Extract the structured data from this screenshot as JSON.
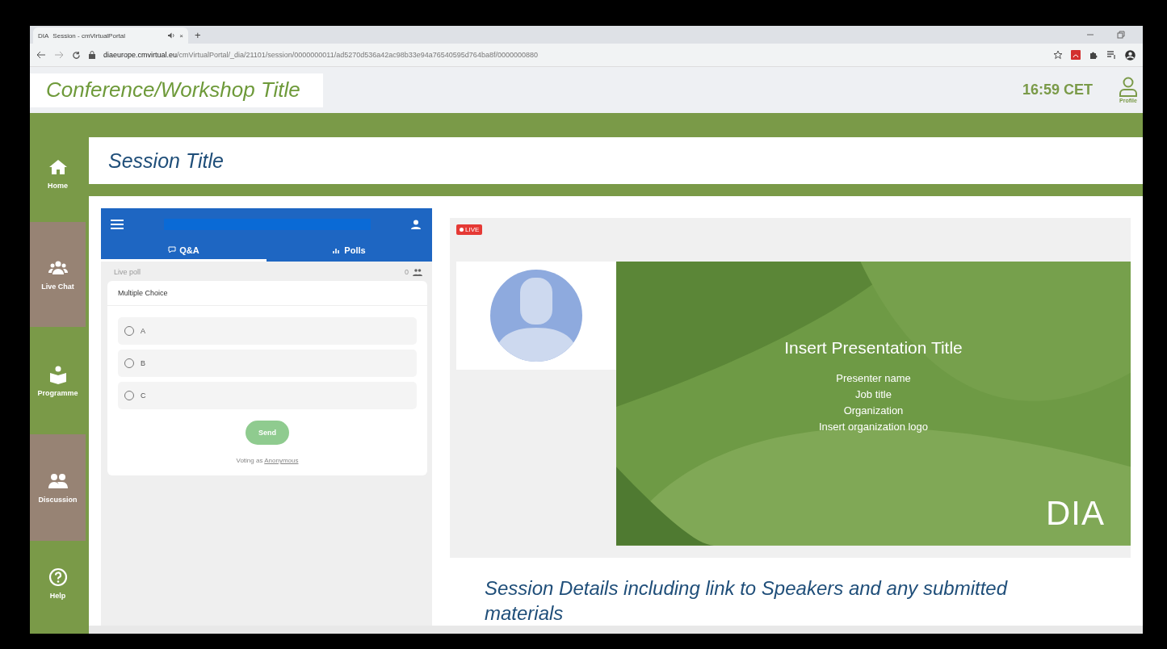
{
  "browser": {
    "tab": {
      "favicon": "DIA",
      "title": "Session - cmVirtualPortal",
      "close": "×"
    },
    "new_tab": "+",
    "url_host": "diaeurope.cmvirtual.eu",
    "url_path": "/cmVirtualPortal/_dia/21101/session/0000000011/ad5270d536a42ac98b33e94a76540595d764ba8f/0000000880"
  },
  "header": {
    "title": "Conference/Workshop Title",
    "time": "16:59 CET",
    "profile": "Profile"
  },
  "sidebar": {
    "items": [
      {
        "label": "Home",
        "kind": "home",
        "color": "#7a9a48"
      },
      {
        "label": "Live Chat",
        "kind": "chat",
        "color": "#978374"
      },
      {
        "label": "Programme",
        "kind": "book",
        "color": "#7a9a48"
      },
      {
        "label": "Discussion",
        "kind": "discussion",
        "color": "#978374"
      },
      {
        "label": "Help",
        "kind": "help",
        "color": "#7a9a48"
      }
    ]
  },
  "session_title": "Session Title",
  "polls": {
    "tabs": [
      {
        "label": "Q&A",
        "kind": "qa",
        "selected": true
      },
      {
        "label": "Polls",
        "kind": "polls",
        "selected": false
      }
    ],
    "live_label": "Live poll",
    "participants": "0",
    "question_type": "Multiple Choice",
    "options": [
      {
        "label": "A",
        "selected": false
      },
      {
        "label": "B",
        "selected": false
      },
      {
        "label": "C",
        "selected": false
      }
    ],
    "send": {
      "label": "Send",
      "disabled": true
    },
    "voting_prefix": "Voting as",
    "voting_name": "Anonymous"
  },
  "video": {
    "live_badge": "LIVE",
    "slide": {
      "title": "Insert Presentation Title",
      "lines": [
        "Presenter name",
        "Job title",
        "Organization",
        "Insert organization logo"
      ],
      "logo": "DIA"
    }
  },
  "details": "Session Details including link to Speakers and any submitted materials"
}
